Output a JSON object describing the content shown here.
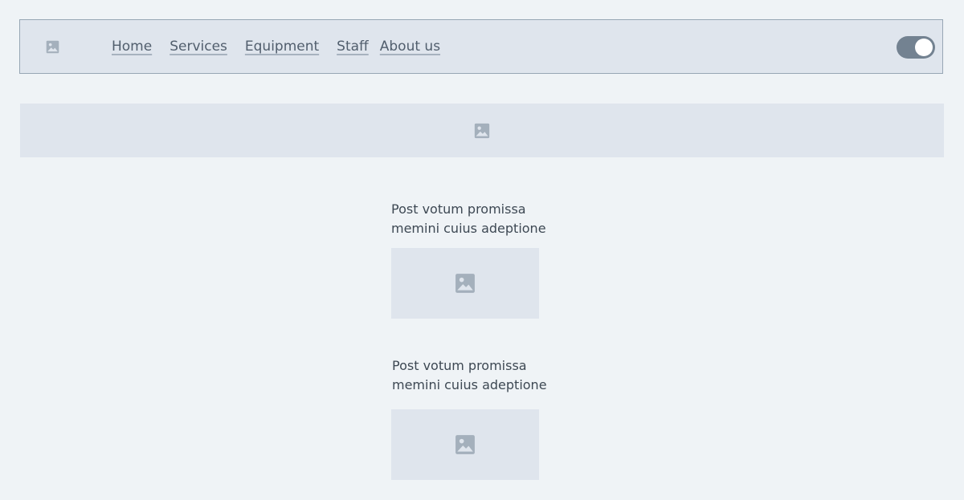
{
  "navbar": {
    "logo_icon": "image-placeholder-icon",
    "links": [
      "Home",
      "Services",
      "Equipment",
      "Staff",
      "About us"
    ],
    "toggle": {
      "state": "on"
    }
  },
  "banner": {
    "icon": "image-placeholder-icon"
  },
  "posts": [
    {
      "title_line1": "Post votum promissa",
      "title_line2": "memini cuius adeptione",
      "icon": "image-placeholder-icon"
    },
    {
      "title_line1": "Post votum promissa",
      "title_line2": "memini cuius adeptione",
      "icon": "image-placeholder-icon"
    }
  ],
  "colors": {
    "background": "#eff3f6",
    "panel": "#dfe5ed",
    "icon": "#a4b0bc",
    "toggle_track": "#738291",
    "text": "#3d4853"
  }
}
